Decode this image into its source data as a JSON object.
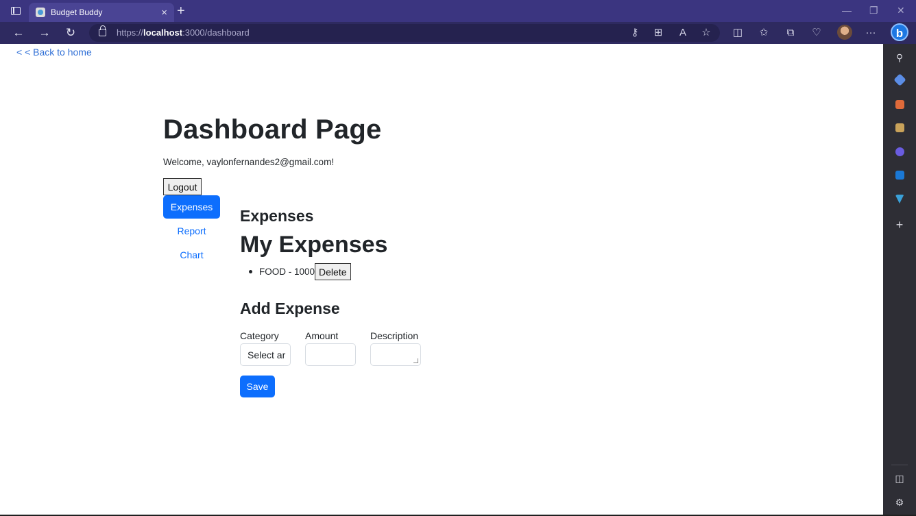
{
  "browser": {
    "tab_title": "Budget Buddy",
    "tab_close": "×",
    "new_tab": "+",
    "url_prefix": "https://",
    "url_host": "localhost",
    "url_rest": ":3000/dashboard",
    "minimize": "—",
    "restore": "❐",
    "close": "✕",
    "more": "···",
    "bing_label": "b"
  },
  "page": {
    "back_link": "< < Back to home",
    "title": "Dashboard Page",
    "welcome": "Welcome, vaylonfernandes2@gmail.com!",
    "logout": "Logout"
  },
  "nav": {
    "expenses": "Expenses",
    "report": "Report",
    "chart": "Chart"
  },
  "expenses": {
    "section_title": "Expenses",
    "list_title": "My Expenses",
    "items": [
      {
        "text": "FOOD - 1000",
        "delete": "Delete"
      }
    ]
  },
  "form": {
    "title": "Add Expense",
    "category_label": "Category",
    "amount_label": "Amount",
    "description_label": "Description",
    "category_value": "Select ar",
    "save": "Save"
  },
  "colors": {
    "titlebar": "#3b3580",
    "addrbar": "#2e2a60",
    "primary": "#0d6efd",
    "sidebar": "#2e2e35"
  }
}
